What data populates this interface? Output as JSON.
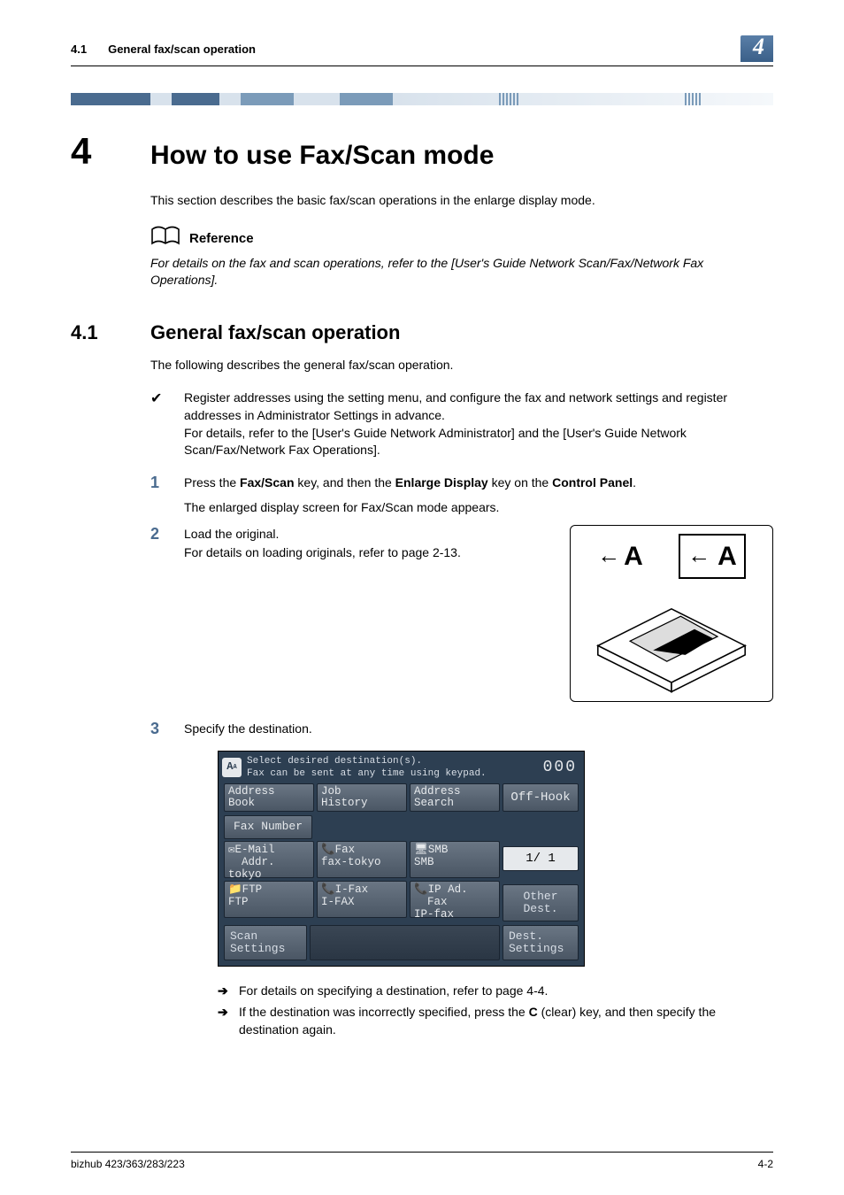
{
  "header": {
    "section": "4.1",
    "title": "General fax/scan operation",
    "chapter": "4"
  },
  "h1": {
    "num": "4",
    "text": "How to use Fax/Scan mode"
  },
  "intro": "This section describes the basic fax/scan operations in the enlarge display mode.",
  "reference": {
    "label": "Reference",
    "text": "For details on the fax and scan operations, refer to the [User's Guide Network Scan/Fax/Network Fax Operations]."
  },
  "h2": {
    "num": "4.1",
    "text": "General fax/scan operation"
  },
  "lead": "The following describes the general fax/scan operation.",
  "check": {
    "line1": "Register addresses using the setting menu, and configure the fax and network settings and register addresses in Administrator Settings in advance.",
    "line2": "For details, refer to the [User's Guide Network Administrator] and the [User's Guide Network Scan/Fax/Network Fax Operations]."
  },
  "steps": {
    "s1": {
      "num": "1",
      "pre": "Press the ",
      "k1": "Fax/Scan",
      "mid1": " key, and then the ",
      "k2": "Enlarge Display",
      "mid2": " key on the ",
      "k3": "Control Panel",
      "post": ".",
      "sub": "The enlarged display screen for Fax/Scan mode appears."
    },
    "s2": {
      "num": "2",
      "line1": "Load the original.",
      "line2": "For details on loading originals, refer to page 2-13."
    },
    "s3": {
      "num": "3",
      "text": "Specify the destination."
    }
  },
  "illus": {
    "a1": "A",
    "a2": "A"
  },
  "screen": {
    "msg1": "Select desired destination(s).",
    "msg2": "Fax can be sent at any time using keypad.",
    "count": "000",
    "tabs": {
      "addrbook1": "Address",
      "addrbook2": "Book",
      "jobhist1": "Job",
      "jobhist2": "History",
      "addrsrch1": "Address",
      "addrsrch2": "Search",
      "offhook": "Off-Hook"
    },
    "faxnum_label": "Fax Number",
    "cells": {
      "email1": "E-Mail",
      "email2": "Addr.",
      "email3": "tokyo",
      "fax1": "Fax",
      "fax2": "fax-tokyo",
      "smb1": "SMB",
      "smb2": "SMB",
      "ftp1": "FTP",
      "ftp2": "FTP",
      "ifax1": "I-Fax",
      "ifax2": "I-FAX",
      "ipad1": "IP Ad.",
      "ipad2": "Fax",
      "ipad3": "IP-fax"
    },
    "page": "1/  1",
    "other1": "Other",
    "other2": "Dest.",
    "scan1": "Scan",
    "scan2": "Settings",
    "dest1": "Dest.",
    "dest2": "Settings"
  },
  "arrows": {
    "a1": "For details on specifying a destination, refer to page 4-4.",
    "a2_pre": "If the destination was incorrectly specified, press the ",
    "a2_key": "C",
    "a2_post": " (clear) key, and then specify the destination again."
  },
  "footer": {
    "model": "bizhub 423/363/283/223",
    "page": "4-2"
  }
}
